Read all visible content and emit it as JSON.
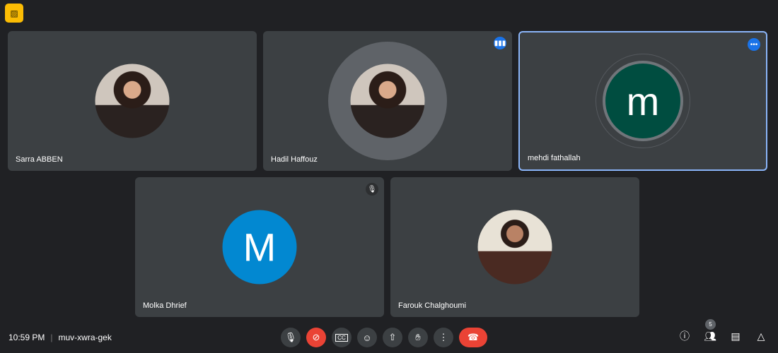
{
  "top_badge": {
    "icon": "camera-off-icon",
    "color": "#fbbc04"
  },
  "participants": [
    {
      "name": "Sarra ABBEN",
      "avatar": "photo"
    },
    {
      "name": "Hadil Haffouz",
      "avatar": "photo",
      "speaking": true
    },
    {
      "name": "mehdi fathallah",
      "avatar_letter": "m",
      "avatar_color": "#004d40",
      "active": true
    },
    {
      "name": "Molka Dhrief",
      "avatar_letter": "M",
      "avatar_color": "#0288d1",
      "muted": true
    },
    {
      "name": "Farouk Chalghoumi",
      "avatar": "photo"
    }
  ],
  "footer": {
    "time": "10:59 PM",
    "meeting_code": "muv-xwra-gek",
    "people_count": "5"
  },
  "colors": {
    "background": "#202124",
    "tile": "#3c4043",
    "end_call": "#ea4335",
    "accent": "#8ab4f8"
  }
}
